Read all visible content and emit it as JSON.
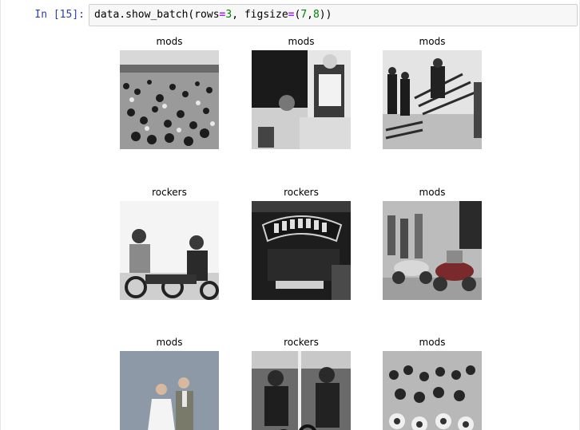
{
  "cell": {
    "prompt": "In [15]:",
    "code": {
      "fn": "data.show_batch(rows",
      "eq1": "=",
      "rows_val": "3",
      "sep": ", figsize",
      "eq2": "=",
      "open": "(",
      "w": "7",
      "comma": ",",
      "h": "8",
      "close": "))"
    }
  },
  "batch": {
    "rows": 3,
    "labels": [
      "mods",
      "mods",
      "mods",
      "rockers",
      "rockers",
      "mods",
      "mods",
      "rockers",
      "mods"
    ]
  }
}
